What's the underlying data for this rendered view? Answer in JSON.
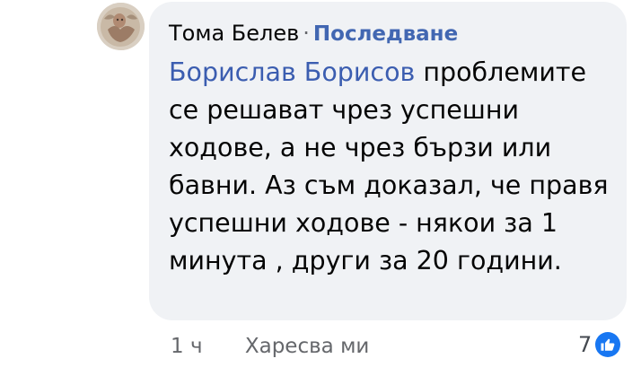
{
  "comment": {
    "author": "Тома Белев",
    "separator": "·",
    "follow_label": "Последване",
    "mention": "Борислав Борисов",
    "text_after_mention": " проблемите се решават чрез успешни ходове, а не чрез бързи или бавни. Аз съм доказал, че правя успешни ходове  - някои за 1 минута , други за 20 години."
  },
  "actions": {
    "time": "1 ч",
    "like_label": "Харесва ми"
  },
  "reactions": {
    "count": "7",
    "icon": "thumbs-up-icon",
    "color": "#1877f2"
  }
}
